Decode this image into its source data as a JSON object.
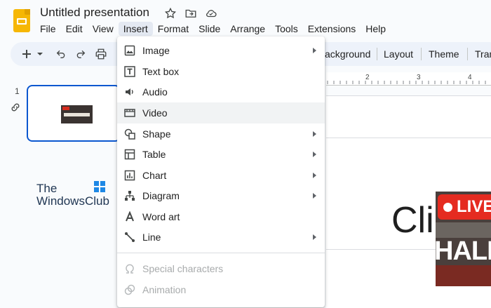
{
  "app": {
    "title": "Untitled presentation"
  },
  "menubar": [
    "File",
    "Edit",
    "View",
    "Insert",
    "Format",
    "Slide",
    "Arrange",
    "Tools",
    "Extensions",
    "Help"
  ],
  "toolbar": {
    "background_label": "ackground",
    "layout_label": "Layout",
    "theme_label": "Theme",
    "transition_label": "Tran"
  },
  "slides_panel": {
    "slide_number": "1"
  },
  "ruler": {
    "ticks": [
      "2",
      "3",
      "4"
    ]
  },
  "canvas": {
    "title_fragment": "Cli",
    "live_badge": "LIVE",
    "overlay_text": "HALF"
  },
  "thumbnail": {
    "alt": "HALF WAY TREE"
  },
  "watermark": {
    "line1": "The",
    "line2": "WindowsClub"
  },
  "insert_menu": {
    "items": [
      {
        "label": "Image",
        "icon": "image-icon",
        "submenu": true,
        "disabled": false
      },
      {
        "label": "Text box",
        "icon": "text-box-icon",
        "submenu": false,
        "disabled": false
      },
      {
        "label": "Audio",
        "icon": "audio-icon",
        "submenu": false,
        "disabled": false
      },
      {
        "label": "Video",
        "icon": "video-icon",
        "submenu": false,
        "disabled": false,
        "highlighted": true
      },
      {
        "label": "Shape",
        "icon": "shape-icon",
        "submenu": true,
        "disabled": false
      },
      {
        "label": "Table",
        "icon": "table-icon",
        "submenu": true,
        "disabled": false
      },
      {
        "label": "Chart",
        "icon": "chart-icon",
        "submenu": true,
        "disabled": false
      },
      {
        "label": "Diagram",
        "icon": "diagram-icon",
        "submenu": true,
        "disabled": false
      },
      {
        "label": "Word art",
        "icon": "word-art-icon",
        "submenu": false,
        "disabled": false
      },
      {
        "label": "Line",
        "icon": "line-icon",
        "submenu": true,
        "disabled": false
      },
      {
        "label": "Special characters",
        "icon": "omega-icon",
        "submenu": false,
        "disabled": true
      },
      {
        "label": "Animation",
        "icon": "animation-icon",
        "submenu": false,
        "disabled": true
      }
    ]
  },
  "colors": {
    "accent": "#0b57d0",
    "brand_yellow": "#f6b704",
    "toolbar_bg": "#edf2fa",
    "menu_highlight": "#f1f3f4"
  }
}
